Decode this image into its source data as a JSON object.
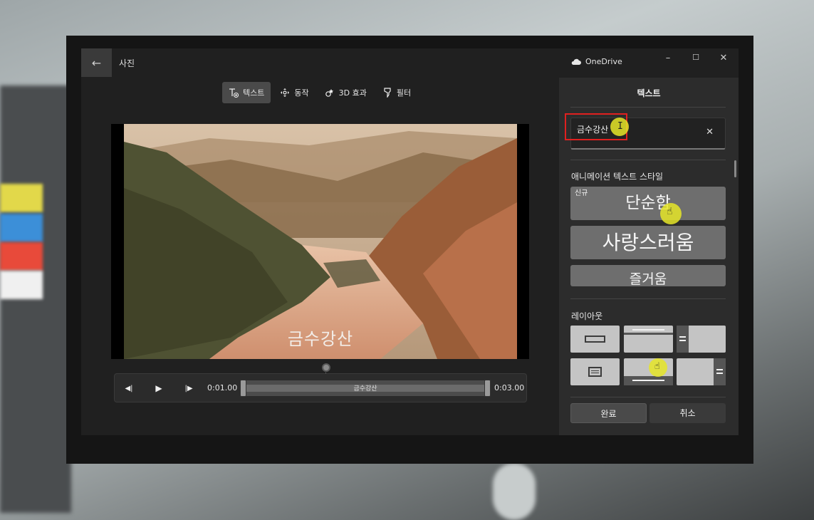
{
  "window": {
    "app_title": "사진",
    "cloud_label": "OneDrive",
    "minimize": "–",
    "maximize": "☐",
    "close": "✕",
    "back": "←"
  },
  "toolbar": {
    "items": [
      {
        "label": "텍스트",
        "icon": "text-add-icon",
        "active": true
      },
      {
        "label": "동작",
        "icon": "motion-icon",
        "active": false
      },
      {
        "label": "3D 효과",
        "icon": "3d-effects-icon",
        "active": false
      },
      {
        "label": "필터",
        "icon": "filter-icon",
        "active": false
      }
    ]
  },
  "preview": {
    "caption": "금수강산"
  },
  "timeline": {
    "start_time": "0:01.00",
    "end_time": "0:03.00",
    "clip_label": "금수강산",
    "prev_frame": "◀|",
    "play": "▶",
    "next_frame": "|▶"
  },
  "panel": {
    "title": "텍스트",
    "text_value": "금수강산",
    "clear": "✕",
    "animation_section": "애니메이션 텍스트 스타일",
    "styles": [
      {
        "label": "단순함",
        "badge": "신규"
      },
      {
        "label": "사랑스러움",
        "badge": ""
      },
      {
        "label": "즐거움",
        "badge": ""
      }
    ],
    "layout_section": "레이아웃",
    "done": "완료",
    "cancel": "취소"
  },
  "colors": {
    "app_bg": "#202020",
    "panel_bg": "#2c2c2c",
    "highlight_red": "#e0201f",
    "cursor_yellow": "#e6e628"
  }
}
